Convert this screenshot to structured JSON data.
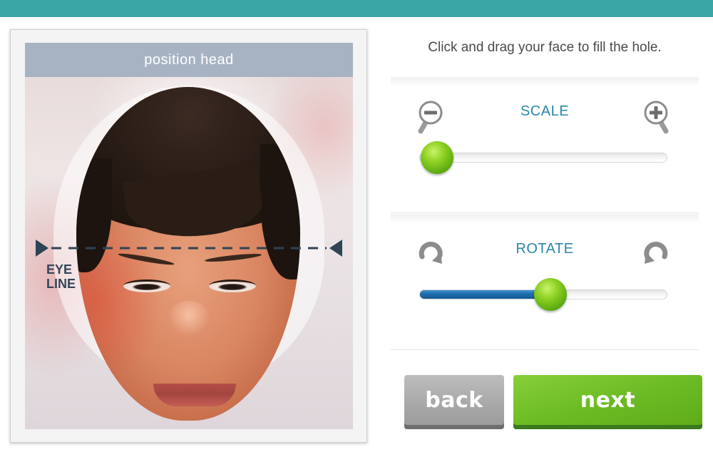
{
  "editor": {
    "header": "position head",
    "eye_line_label_1": "EYE",
    "eye_line_label_2": "LINE"
  },
  "instruction": "Click and drag your face to fill the hole.",
  "controls": {
    "scale": {
      "label": "SCALE",
      "min_icon": "zoom-out-icon",
      "max_icon": "zoom-in-icon",
      "value_fraction": 0.07
    },
    "rotate": {
      "label": "ROTATE",
      "left_icon": "rotate-clockwise-icon",
      "right_icon": "rotate-counterclockwise-icon",
      "value_fraction": 0.53
    }
  },
  "buttons": {
    "back": "back",
    "next": "next"
  },
  "colors": {
    "accent_teal": "#3aa7a6",
    "label_blue": "#2a86a8",
    "slider_fill": "#1c6aa8",
    "thumb_green": "#7cc41c",
    "next_green": "#6cbb24",
    "back_gray": "#a6a6a6"
  }
}
